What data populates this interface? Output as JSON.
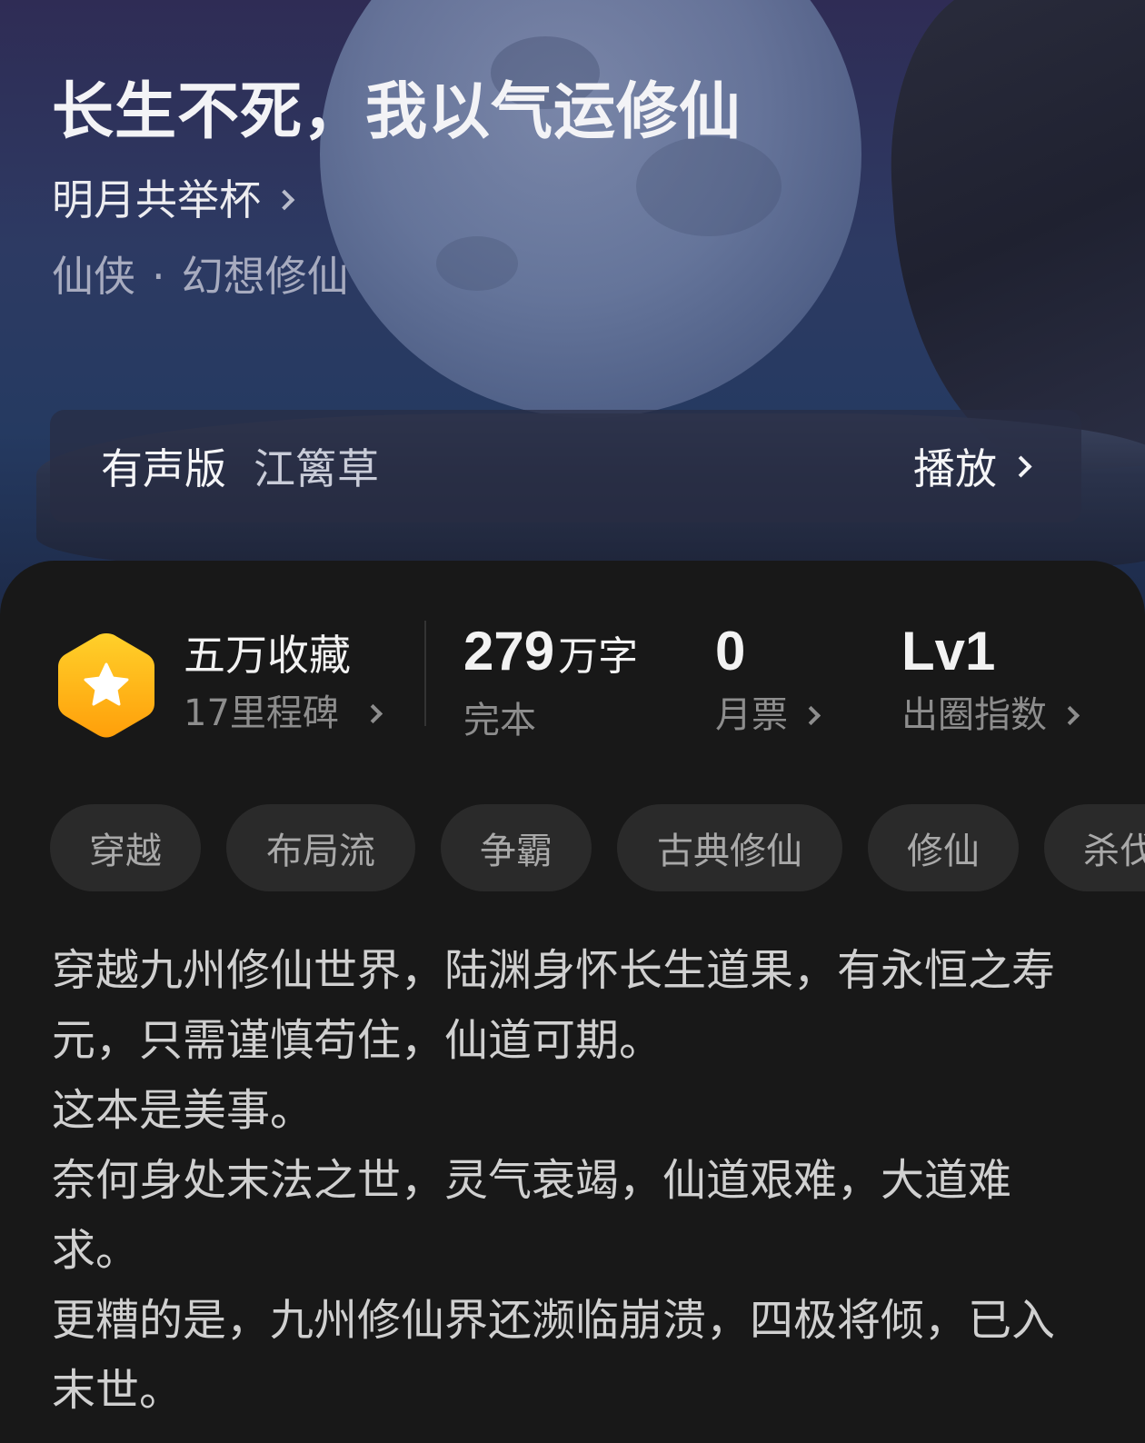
{
  "book": {
    "title": "长生不死，我以气运修仙",
    "author": "明月共举杯",
    "genre": "仙侠",
    "subgenre": "幻想修仙",
    "genre_separator": "·"
  },
  "audio": {
    "label": "有声版",
    "narrator": "江篱草",
    "play_label": "播放"
  },
  "stats": {
    "favorites": "五万收藏",
    "milestones": "17里程碑",
    "word_count_value": "279",
    "word_count_unit": "万字",
    "status": "完本",
    "monthly_tickets_value": "0",
    "monthly_tickets_label": "月票",
    "popularity_value": "Lv1",
    "popularity_label": "出圈指数"
  },
  "tags": [
    "穿越",
    "布局流",
    "争霸",
    "古典修仙",
    "修仙",
    "杀伐"
  ],
  "synopsis": [
    "穿越九州修仙世界，陆渊身怀长生道果，有永恒之寿元，只需谨慎苟住，仙道可期。",
    "这本是美事。",
    "奈何身处末法之世，灵气衰竭，仙道艰难，大道难求。",
    "更糟的是，九州修仙界还濒临崩溃，四极将倾，已入末世。"
  ],
  "colors": {
    "badge_gradient_top": "#ffd02a",
    "badge_gradient_bottom": "#ff9f0a",
    "panel_background": "#181818",
    "tag_background": "#2a2a2a"
  }
}
